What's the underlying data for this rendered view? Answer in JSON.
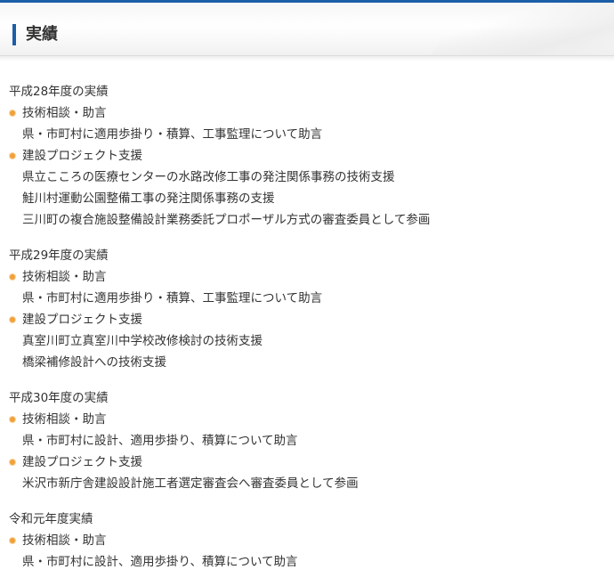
{
  "header": {
    "title": "実績"
  },
  "years": [
    {
      "title": "平成28年度の実績",
      "categories": [
        {
          "label": "技術相談・助言",
          "items": [
            "県・市町村に適用歩掛り・積算、工事監理について助言"
          ]
        },
        {
          "label": "建設プロジェクト支援",
          "items": [
            "県立こころの医療センターの水路改修工事の発注関係事務の技術支援",
            "鮭川村運動公園整備工事の発注関係事務の支援",
            "三川町の複合施設整備設計業務委託プロポーザル方式の審査委員として参画"
          ]
        }
      ]
    },
    {
      "title": "平成29年度の実績",
      "categories": [
        {
          "label": "技術相談・助言",
          "items": [
            "県・市町村に適用歩掛り・積算、工事監理について助言"
          ]
        },
        {
          "label": "建設プロジェクト支援",
          "items": [
            "真室川町立真室川中学校改修検討の技術支援",
            "橋梁補修設計への技術支援"
          ]
        }
      ]
    },
    {
      "title": "平成30年度の実績",
      "categories": [
        {
          "label": "技術相談・助言",
          "items": [
            "県・市町村に設計、適用歩掛り、積算について助言"
          ]
        },
        {
          "label": "建設プロジェクト支援",
          "items": [
            "米沢市新庁舎建設設計施工者選定審査会へ審査委員として参画"
          ]
        }
      ]
    },
    {
      "title": "令和元年度実績",
      "categories": [
        {
          "label": "技術相談・助言",
          "items": [
            "県・市町村に設計、適用歩掛り、積算について助言"
          ]
        }
      ]
    }
  ],
  "colors": {
    "accent": "#1c5ea8",
    "bullet": "#f0a13a",
    "text": "#333333"
  }
}
